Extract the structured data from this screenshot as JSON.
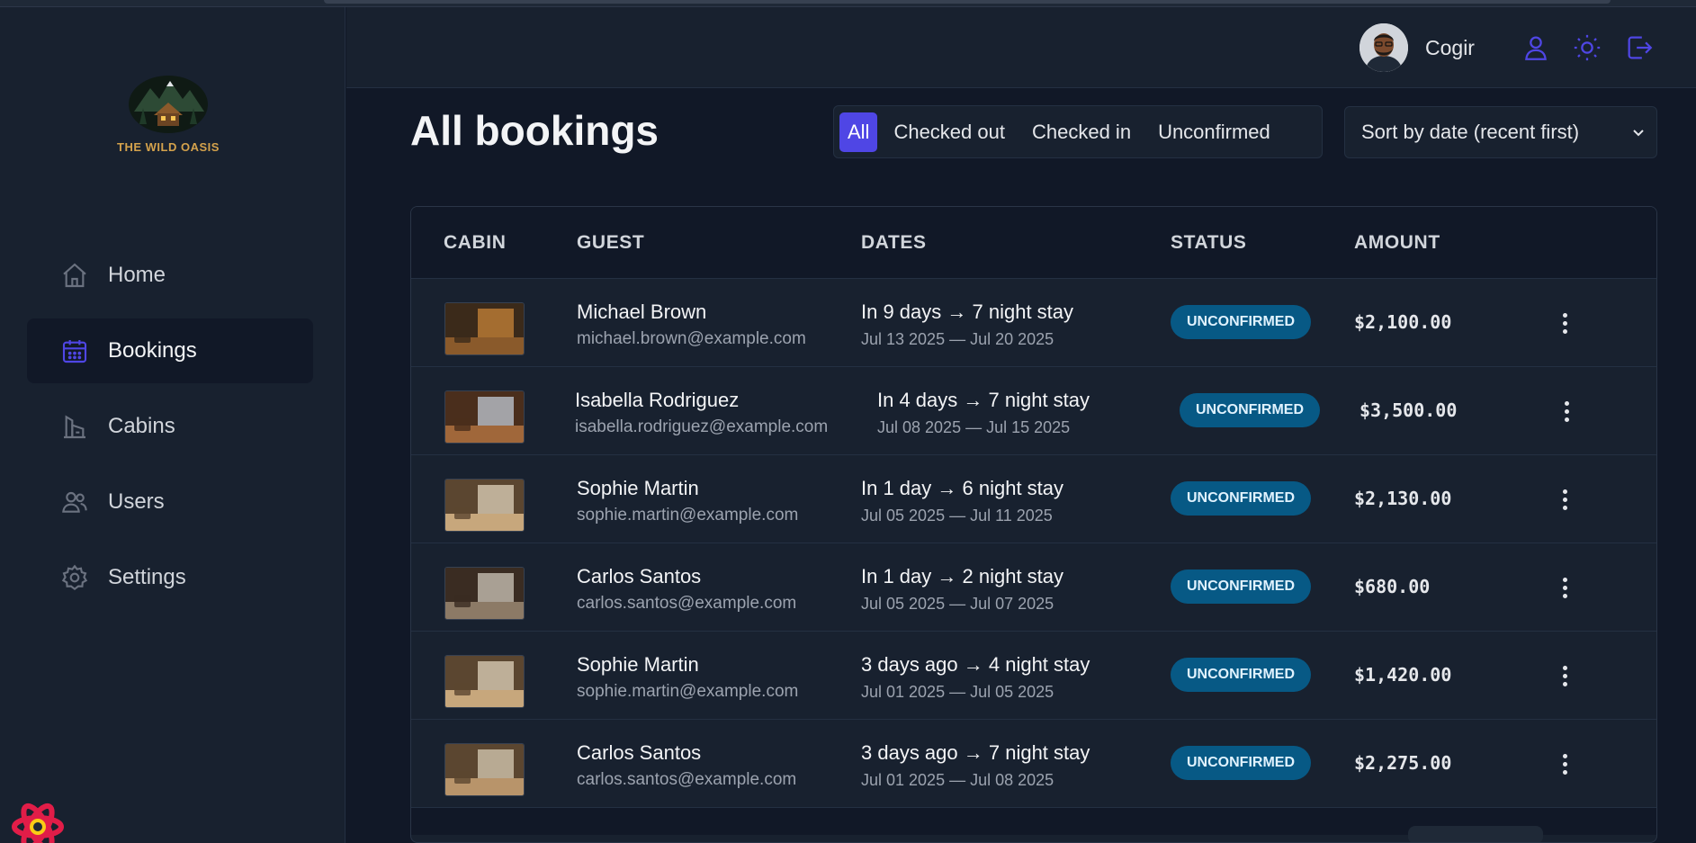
{
  "brand": {
    "name": "THE WILD OASIS"
  },
  "nav": {
    "items": [
      {
        "label": "Home",
        "icon": "home-icon",
        "active": false
      },
      {
        "label": "Bookings",
        "icon": "calendar-icon",
        "active": true
      },
      {
        "label": "Cabins",
        "icon": "cabins-icon",
        "active": false
      },
      {
        "label": "Users",
        "icon": "users-icon",
        "active": false
      },
      {
        "label": "Settings",
        "icon": "gear-icon",
        "active": false
      }
    ]
  },
  "header": {
    "username": "Cogir",
    "icons": [
      "user-icon",
      "sun-icon",
      "logout-icon"
    ]
  },
  "page": {
    "title": "All bookings"
  },
  "filter": {
    "options": [
      "All",
      "Checked out",
      "Checked in",
      "Unconfirmed"
    ],
    "active": "All"
  },
  "sort": {
    "selected": "Sort by date (recent first)"
  },
  "table": {
    "headers": [
      "CABIN",
      "GUEST",
      "DATES",
      "STATUS",
      "AMOUNT"
    ],
    "rows": [
      {
        "name": "Michael Brown",
        "email": "michael.brown@example.com",
        "dates": "In 9 days → 7 night stay",
        "range": "Jul 13 2025 — Jul 20 2025",
        "status": "UNCONFIRMED",
        "amount": "$2,100.00"
      },
      {
        "name": "Isabella Rodriguez",
        "email": "isabella.rodriguez@example.com",
        "dates": "In 4 days → 7 night stay",
        "range": "Jul 08 2025 — Jul 15 2025",
        "status": "UNCONFIRMED",
        "amount": "$3,500.00"
      },
      {
        "name": "Sophie Martin",
        "email": "sophie.martin@example.com",
        "dates": "In 1 day → 6 night stay",
        "range": "Jul 05 2025 — Jul 11 2025",
        "status": "UNCONFIRMED",
        "amount": "$2,130.00"
      },
      {
        "name": "Carlos Santos",
        "email": "carlos.santos@example.com",
        "dates": "In 1 day → 2 night stay",
        "range": "Jul 05 2025 — Jul 07 2025",
        "status": "UNCONFIRMED",
        "amount": "$680.00"
      },
      {
        "name": "Sophie Martin",
        "email": "sophie.martin@example.com",
        "dates": "3 days ago → 4 night stay",
        "range": "Jul 01 2025 — Jul 05 2025",
        "status": "UNCONFIRMED",
        "amount": "$1,420.00"
      },
      {
        "name": "Carlos Santos",
        "email": "carlos.santos@example.com",
        "dates": "3 days ago → 7 night stay",
        "range": "Jul 01 2025 — Jul 08 2025",
        "status": "UNCONFIRMED",
        "amount": "$2,275.00"
      }
    ]
  },
  "colors": {
    "accent": "#4f46e5",
    "badge_bg": "#075985",
    "background": "#111827",
    "panel": "#18212f"
  }
}
